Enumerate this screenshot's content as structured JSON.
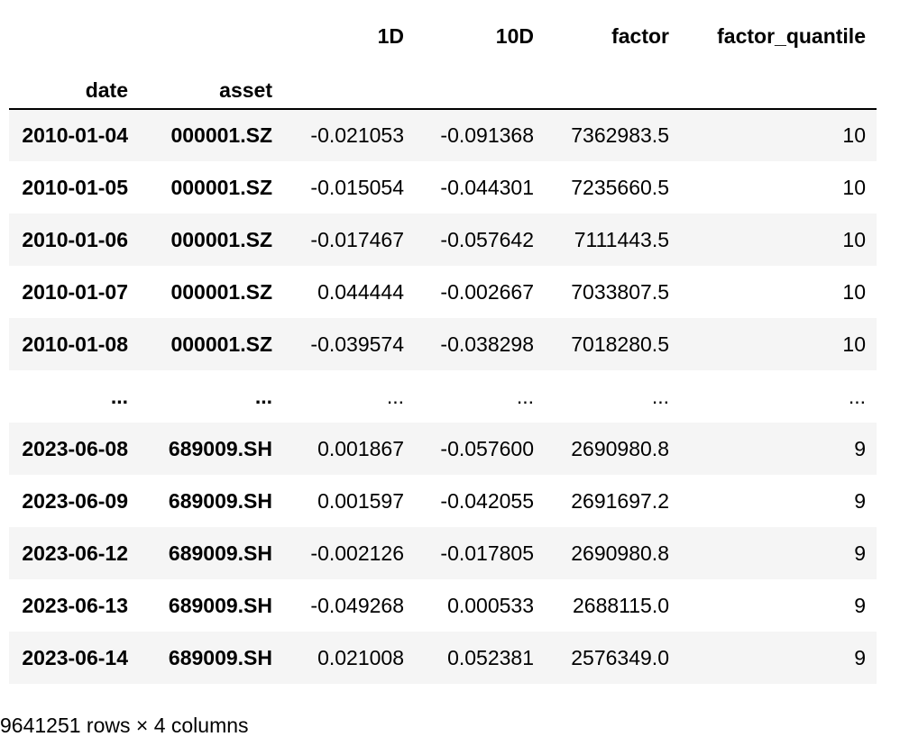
{
  "table": {
    "columns": [
      "1D",
      "10D",
      "factor",
      "factor_quantile"
    ],
    "index_names": [
      "date",
      "asset"
    ],
    "rows": [
      {
        "date": "2010-01-04",
        "asset": "000001.SZ",
        "d1": "-0.021053",
        "d10": "-0.091368",
        "factor": "7362983.5",
        "quantile": "10"
      },
      {
        "date": "2010-01-05",
        "asset": "000001.SZ",
        "d1": "-0.015054",
        "d10": "-0.044301",
        "factor": "7235660.5",
        "quantile": "10"
      },
      {
        "date": "2010-01-06",
        "asset": "000001.SZ",
        "d1": "-0.017467",
        "d10": "-0.057642",
        "factor": "7111443.5",
        "quantile": "10"
      },
      {
        "date": "2010-01-07",
        "asset": "000001.SZ",
        "d1": "0.044444",
        "d10": "-0.002667",
        "factor": "7033807.5",
        "quantile": "10"
      },
      {
        "date": "2010-01-08",
        "asset": "000001.SZ",
        "d1": "-0.039574",
        "d10": "-0.038298",
        "factor": "7018280.5",
        "quantile": "10"
      },
      {
        "date": "...",
        "asset": "...",
        "d1": "...",
        "d10": "...",
        "factor": "...",
        "quantile": "..."
      },
      {
        "date": "2023-06-08",
        "asset": "689009.SH",
        "d1": "0.001867",
        "d10": "-0.057600",
        "factor": "2690980.8",
        "quantile": "9"
      },
      {
        "date": "2023-06-09",
        "asset": "689009.SH",
        "d1": "0.001597",
        "d10": "-0.042055",
        "factor": "2691697.2",
        "quantile": "9"
      },
      {
        "date": "2023-06-12",
        "asset": "689009.SH",
        "d1": "-0.002126",
        "d10": "-0.017805",
        "factor": "2690980.8",
        "quantile": "9"
      },
      {
        "date": "2023-06-13",
        "asset": "689009.SH",
        "d1": "-0.049268",
        "d10": "0.000533",
        "factor": "2688115.0",
        "quantile": "9"
      },
      {
        "date": "2023-06-14",
        "asset": "689009.SH",
        "d1": "0.021008",
        "d10": "0.052381",
        "factor": "2576349.0",
        "quantile": "9"
      }
    ]
  },
  "caption": "9641251 rows × 4 columns"
}
